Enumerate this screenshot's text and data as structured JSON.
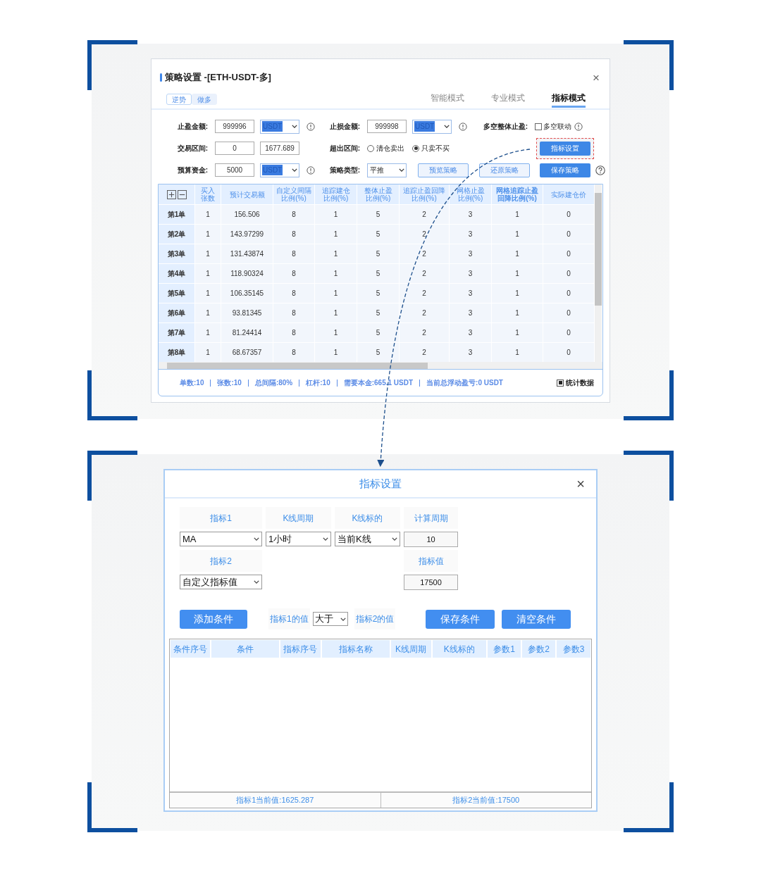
{
  "strategy_dialog": {
    "title": "策略设置 -[ETH-USDT-多]",
    "close": "×",
    "tags": [
      {
        "label": "逆势",
        "selected": true
      },
      {
        "label": "做多",
        "selected": false
      }
    ],
    "modes": [
      {
        "label": "智能模式",
        "selected": false
      },
      {
        "label": "专业模式",
        "selected": false
      },
      {
        "label": "指标模式",
        "selected": true
      }
    ],
    "form_rows": [
      [
        {
          "kind": "label",
          "text": "止盈金额:"
        },
        {
          "kind": "input",
          "value": "999996"
        },
        {
          "kind": "select",
          "value": "USDT",
          "highlighted": true
        },
        {
          "kind": "info"
        },
        {
          "kind": "label",
          "text": "止损金额:"
        },
        {
          "kind": "input",
          "value": "999998"
        },
        {
          "kind": "select",
          "value": "USDT",
          "highlighted": true
        },
        {
          "kind": "info"
        },
        {
          "kind": "label",
          "text": "多空整体止盈:"
        },
        {
          "kind": "checkbox",
          "label": "多空联动",
          "checked": false
        },
        {
          "kind": "info"
        }
      ],
      [
        {
          "kind": "label",
          "text": "交易区间:"
        },
        {
          "kind": "input",
          "value": "0"
        },
        {
          "kind": "input",
          "value": "1677.689"
        },
        {
          "kind": "label",
          "text": "超出区间:"
        },
        {
          "kind": "radio",
          "label": "清仓卖出",
          "selected": false
        },
        {
          "kind": "radio",
          "label": "只卖不买",
          "selected": true
        },
        {
          "kind": "primary_button",
          "label": "指标设置",
          "highlighted": true
        }
      ],
      [
        {
          "kind": "label",
          "text": "预算资金:"
        },
        {
          "kind": "input",
          "value": "5000"
        },
        {
          "kind": "select",
          "value": "USDT",
          "highlighted": true
        },
        {
          "kind": "info"
        },
        {
          "kind": "label",
          "text": "策略类型:"
        },
        {
          "kind": "select",
          "value": "平推",
          "highlighted": false
        },
        {
          "kind": "outline_button",
          "label": "预览策略",
          "highlighted": false
        },
        {
          "kind": "outline_button",
          "label": "还原策略",
          "highlighted": false
        },
        {
          "kind": "primary_button",
          "label": "保存策略",
          "highlighted": false
        },
        {
          "kind": "help"
        }
      ]
    ],
    "table": {
      "columns": [
        {
          "label": "买入张数",
          "bold": false
        },
        {
          "label": "预计交易额",
          "bold": false
        },
        {
          "label": "自定义间隔比例(%)",
          "bold": false
        },
        {
          "label": "追踪建仓比例(%)",
          "bold": false
        },
        {
          "label": "整体止盈比例(%)",
          "bold": false
        },
        {
          "label": "追踪止盈回降比例(%)",
          "bold": false
        },
        {
          "label": "网格止盈比例(%)",
          "bold": false
        },
        {
          "label": "网格追踪止盈回降比例(%)",
          "bold": true
        },
        {
          "label": "实际建仓价",
          "bold": false
        }
      ],
      "rows": [
        {
          "label": "第1单",
          "cells": [
            "1",
            "156.506",
            "8",
            "1",
            "5",
            "2",
            "3",
            "1",
            "0"
          ]
        },
        {
          "label": "第2单",
          "cells": [
            "1",
            "143.97299",
            "8",
            "1",
            "5",
            "2",
            "3",
            "1",
            "0"
          ]
        },
        {
          "label": "第3单",
          "cells": [
            "1",
            "131.43874",
            "8",
            "1",
            "5",
            "2",
            "3",
            "1",
            "0"
          ]
        },
        {
          "label": "第4单",
          "cells": [
            "1",
            "118.90324",
            "8",
            "1",
            "5",
            "2",
            "3",
            "1",
            "0"
          ]
        },
        {
          "label": "第5单",
          "cells": [
            "1",
            "106.35145",
            "8",
            "1",
            "5",
            "2",
            "3",
            "1",
            "0"
          ]
        },
        {
          "label": "第6单",
          "cells": [
            "1",
            "93.81345",
            "8",
            "1",
            "5",
            "2",
            "3",
            "1",
            "0"
          ]
        },
        {
          "label": "第7单",
          "cells": [
            "1",
            "81.24414",
            "8",
            "1",
            "5",
            "2",
            "3",
            "1",
            "0"
          ]
        },
        {
          "label": "第8单",
          "cells": [
            "1",
            "68.67357",
            "8",
            "1",
            "5",
            "2",
            "3",
            "1",
            "0"
          ]
        }
      ]
    },
    "stats": [
      "单数:10",
      "张数:10",
      "总间隔:80%",
      "杠杆:10",
      "需要本金:665.1 USDT",
      "当前总浮动盈亏:0 USDT"
    ],
    "stats_checkbox": {
      "label": "统计数据",
      "checked": true
    }
  },
  "indicator_dialog": {
    "title": "指标设置",
    "close": "×",
    "fields": [
      {
        "label": "指标1",
        "kind": "select",
        "value": "MA"
      },
      {
        "label": "K线周期",
        "kind": "select",
        "value": "1小时"
      },
      {
        "label": "K线标的",
        "kind": "select",
        "value": "当前K线"
      },
      {
        "label": "计算周期",
        "kind": "input",
        "value": "10"
      },
      {
        "label": "指标2",
        "kind": "select",
        "value": "自定义指标值"
      },
      {
        "label": "指标值",
        "kind": "input",
        "value": "17500"
      }
    ],
    "add_button": "添加条件",
    "compare_left": "指标1的值",
    "compare_op": "大于",
    "compare_right": "指标2的值",
    "save_button": "保存条件",
    "clear_button": "清空条件",
    "columns": [
      "条件序号",
      "条件",
      "指标序号",
      "指标名称",
      "K线周期",
      "K线标的",
      "参数1",
      "参数2",
      "参数3"
    ],
    "footer": [
      "指标1当前值:1625.287",
      "指标2当前值:17500"
    ]
  }
}
